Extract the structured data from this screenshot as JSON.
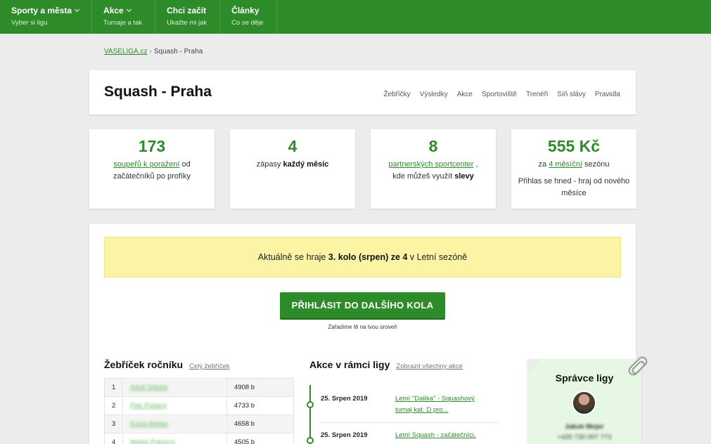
{
  "nav": [
    {
      "title": "Sporty a města",
      "sub": "Vyber si ligu",
      "has_dropdown": true
    },
    {
      "title": "Akce",
      "sub": "Turnaje a tak",
      "has_dropdown": true
    },
    {
      "title": "Chci začít",
      "sub": "Ukažte mi jak",
      "has_dropdown": false
    },
    {
      "title": "Články",
      "sub": "Co se děje",
      "has_dropdown": false
    }
  ],
  "breadcrumb": {
    "home": "VASELIGA.cz",
    "separator": "›",
    "current": "Squash - Praha"
  },
  "page": {
    "title": "Squash - Praha"
  },
  "subnav": [
    "Žebříčky",
    "Výsledky",
    "Akce",
    "Sportoviště",
    "Trenéři",
    "Síň slávy",
    "Pravidla"
  ],
  "stats": [
    {
      "number": "173",
      "link": "soupeřů k poražení",
      "text_after": "od",
      "line2": "začátečníků po profíky"
    },
    {
      "number": "4",
      "text_before": "zápasy",
      "bold": "každý měsíc"
    },
    {
      "number": "8",
      "link": "partnerských sportcenter",
      "text_after": ",",
      "line2_before": "kde můžeš využít",
      "bold": "slevy"
    },
    {
      "number": "555 Kč",
      "text_before": "za",
      "link": "4 měsíční",
      "text_after": "sezónu",
      "line2": "Přihlas se hned - hraj od nového měsíce"
    }
  ],
  "banner": {
    "before": "Aktuálně se hraje",
    "bold": "3. kolo (srpen) ze 4",
    "after": "v Letní sezóně"
  },
  "cta": {
    "label": "PŘIHLÁSIT DO DALŠÍHO KOLA",
    "sub": "Zařadíme tě na tvou úroveň"
  },
  "ladder": {
    "title": "Žebříček ročníku",
    "link": "Celý žebříček",
    "rows": [
      {
        "rank": "1",
        "name": "Adolf Sílloba",
        "points": "4908 b"
      },
      {
        "rank": "2",
        "name": "Petr Podaný",
        "points": "4733 b"
      },
      {
        "rank": "3",
        "name": "Kosta Beltan",
        "points": "4658 b"
      },
      {
        "rank": "4",
        "name": "Martin Pokorny",
        "points": "4505 b"
      }
    ]
  },
  "events": {
    "title": "Akce v rámci ligy",
    "link": "Zobrazit všechny akce",
    "items": [
      {
        "date": "25. Srpen 2019",
        "name": "Letní \"Dalíka\" - Squashový turnaj kat. D pro..."
      },
      {
        "date": "25. Srpen 2019",
        "name": "Letní Squash - začátečníci,"
      }
    ]
  },
  "admin": {
    "title": "Správce ligy",
    "name": "Jakub Mojer",
    "phone": "+420 730 007 773"
  }
}
